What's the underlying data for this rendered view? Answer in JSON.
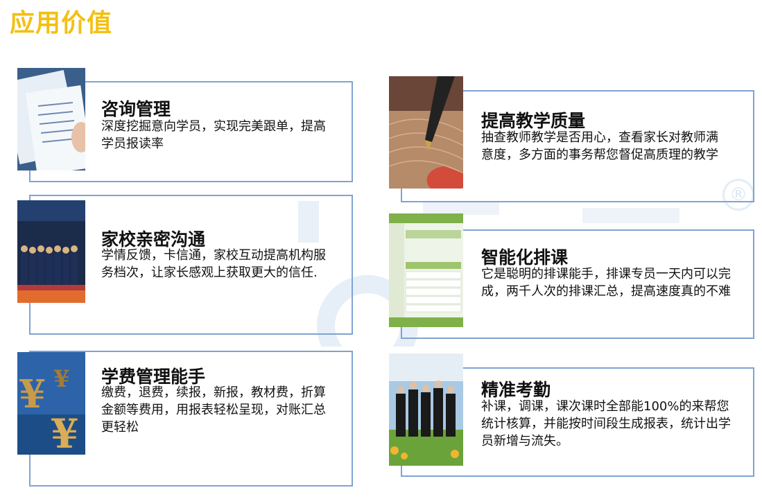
{
  "page": {
    "title": "应用价值"
  },
  "watermark": {
    "registered_mark": "®"
  },
  "cards": [
    {
      "title": "咨询管理",
      "desc": "深度挖掘意向学员，实现完美跟单，提高学员报读率",
      "image_icon": "documents-photo"
    },
    {
      "title": "家校亲密沟通",
      "desc": "学情反馈，卡信通，家校互动提高机构服务档次，让家长感观上获取更大的信任.",
      "image_icon": "graduation-ceremony-photo"
    },
    {
      "title": "学费管理能手",
      "desc": "缴费，退费，续报，新报，教材费，折算金额等费用，用报表轻松呈现，对账汇总更轻松",
      "image_icon": "currency-symbols-photo"
    },
    {
      "title": "提高教学质量",
      "desc": "抽查教师教学是否用心，查看家长对教师满意度，多方面的事务帮您督促高质理的教学",
      "image_icon": "fountain-pen-photo"
    },
    {
      "title": "智能化排课",
      "desc": "它是聪明的排课能手，排课专员一天内可以完成，两千人次的排课汇总，提高速度真的不难",
      "image_icon": "software-screenshot-photo"
    },
    {
      "title": "精准考勤",
      "desc": "补课，调课，课次课时全部能100%的来帮您统计核算，并能按时间段生成报表，统计出学员新增与流失。",
      "image_icon": "graduates-photo"
    }
  ]
}
